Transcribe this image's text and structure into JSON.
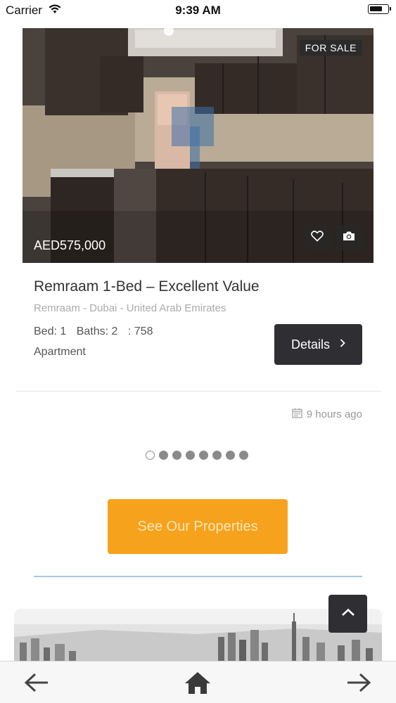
{
  "status_bar": {
    "carrier": "Carrier",
    "time": "9:39 AM"
  },
  "listing": {
    "badge": "FOR SALE",
    "price": "AED575,000",
    "title": "Remraam 1-Bed – Excellent Value",
    "location": "Remraam - Dubai - United Arab Emirates",
    "bed": "Bed: 1",
    "baths": "Baths: 2",
    "area": ": 758",
    "type": "Apartment",
    "details_label": "Details",
    "posted": "9 hours ago"
  },
  "carousel": {
    "count": 8,
    "active": 0
  },
  "cta": {
    "label": "See Our Properties"
  },
  "colors": {
    "accent": "#f7a21c",
    "dark_button": "#2f2f33",
    "separator": "#a8c8e6"
  },
  "icons": [
    "wifi-icon",
    "battery-icon",
    "heart-icon",
    "camera-icon",
    "chevron-right-icon",
    "calendar-icon",
    "chevron-up-icon",
    "arrow-left-icon",
    "home-icon",
    "arrow-right-icon"
  ]
}
